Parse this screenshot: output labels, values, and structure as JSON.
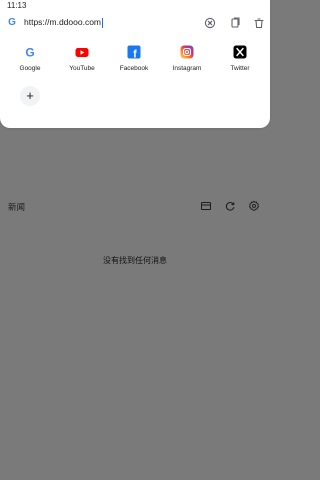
{
  "status_bar": {
    "time": "11:13"
  },
  "url_bar": {
    "url": "https://m.ddooo.com",
    "icons": [
      "google-g-icon",
      "clear-icon",
      "copy-icon",
      "delete-icon"
    ]
  },
  "shortcuts": [
    {
      "label": "Google",
      "icon": "google-icon"
    },
    {
      "label": "YouTube",
      "icon": "youtube-icon"
    },
    {
      "label": "Facebook",
      "icon": "facebook-icon"
    },
    {
      "label": "Instagram",
      "icon": "instagram-icon"
    },
    {
      "label": "Twitter",
      "icon": "x-icon"
    }
  ],
  "add_shortcut": {
    "symbol": "+"
  },
  "news": {
    "title": "新闻",
    "empty_message": "没有找到任何消息",
    "actions": [
      "card-layout-icon",
      "refresh-icon",
      "settings-icon"
    ]
  },
  "colors": {
    "scrim": "#7a7a7a",
    "card": "#ffffff",
    "accent": "#1a73e8",
    "youtube": "#ff0000",
    "facebook": "#1877f2",
    "x": "#000000"
  }
}
